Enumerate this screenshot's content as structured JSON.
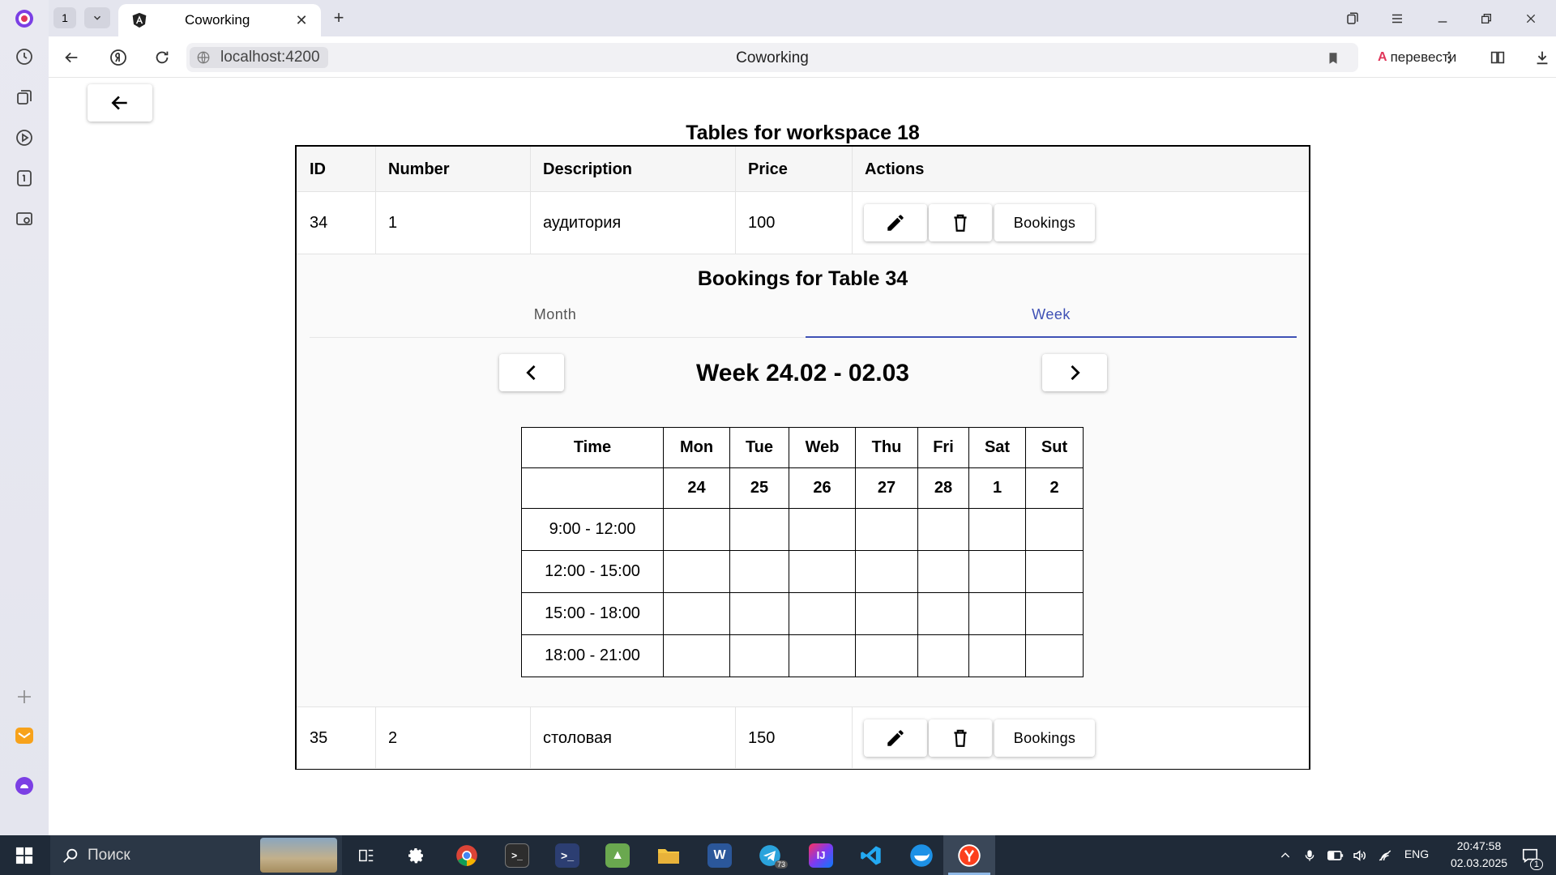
{
  "browser": {
    "tab_count": "1",
    "tab_title": "Coworking",
    "url": "localhost:4200",
    "page_title": "Coworking",
    "translate_label": "перевести"
  },
  "page": {
    "heading": "Tables for workspace 18",
    "columns": [
      "ID",
      "Number",
      "Description",
      "Price",
      "Actions"
    ],
    "rows": [
      {
        "id": "34",
        "number": "1",
        "description": "аудитория",
        "price": "100"
      },
      {
        "id": "35",
        "number": "2",
        "description": "столовая",
        "price": "150"
      }
    ],
    "bookings_button_label": "Bookings"
  },
  "bookings": {
    "title": "Bookings for Table 34",
    "tabs": {
      "month": "Month",
      "week": "Week",
      "active": "week"
    },
    "week_label": "Week 24.02 - 02.03",
    "calendar": {
      "time_header": "Time",
      "days": [
        "Mon",
        "Tue",
        "Web",
        "Thu",
        "Fri",
        "Sat",
        "Sut"
      ],
      "dates": [
        "24",
        "25",
        "26",
        "27",
        "28",
        "1",
        "2"
      ],
      "slots": [
        "9:00 - 12:00",
        "12:00 - 15:00",
        "15:00 - 18:00",
        "18:00 - 21:00"
      ]
    }
  },
  "taskbar": {
    "search_label": "Поиск",
    "language": "ENG",
    "time": "20:47:58",
    "date": "02.03.2025",
    "notification_count": "1",
    "telegram_badge": "73"
  },
  "colors": {
    "accent": "#3f51b5",
    "taskbar": "#1f2a38"
  }
}
